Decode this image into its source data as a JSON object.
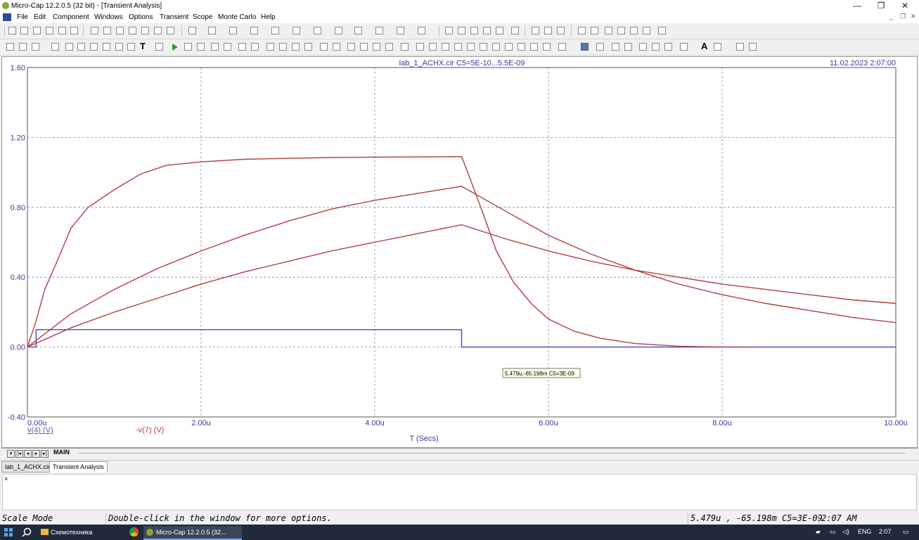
{
  "window": {
    "title": "Micro-Cap 12.2.0.5 (32 bit) - [Transient Analysis]",
    "controls": [
      "—",
      "❐",
      "✕"
    ]
  },
  "menu": {
    "items": [
      "File",
      "Edit",
      "Component",
      "Windows",
      "Options",
      "Transient",
      "Scope",
      "Monte Carlo",
      "Help"
    ],
    "mdi_controls": [
      "_",
      "❐",
      "✕"
    ]
  },
  "plot": {
    "title": "lab_1_ACHX.cir C5=5E-10...5.5E-09",
    "timestamp": "11.02.2023 2:07:00",
    "cursor_readout": "5.479u,-65.198m C5=3E-09",
    "xlabel": "T (Secs)",
    "legend": [
      "v(4) (V)",
      "-v(7) (V)"
    ]
  },
  "chart_data": {
    "type": "line",
    "title": "lab_1_ACHX.cir C5=5E-10...5.5E-09",
    "xlabel": "T (Secs)",
    "ylabel": "",
    "xlim": [
      0,
      10
    ],
    "ylim": [
      -0.4,
      1.6
    ],
    "x_unit": "u",
    "xticks": [
      0,
      2,
      4,
      6,
      8,
      10
    ],
    "xtick_labels": [
      "0.00u",
      "2.00u",
      "4.00u",
      "6.00u",
      "8.00u",
      "10.00u"
    ],
    "yticks": [
      -0.4,
      0,
      0.4,
      0.8,
      1.2,
      1.6
    ],
    "ytick_labels": [
      "-0.40",
      "0.00",
      "0.40",
      "0.80",
      "1.20",
      "1.60"
    ],
    "grid": true,
    "series": [
      {
        "name": "v(4) (V)",
        "color": "#4848b8",
        "x": [
          0,
          0.1,
          0.1,
          5.0,
          5.0,
          10.0
        ],
        "y": [
          0,
          0,
          0.1,
          0.1,
          0,
          0
        ]
      },
      {
        "name": "-v(7) (V)",
        "color": "#b04040",
        "x": [
          0,
          0.1,
          0.2,
          0.35,
          0.5,
          0.7,
          1.0,
          1.3,
          1.6,
          2.0,
          2.5,
          3.0,
          3.5,
          4.0,
          4.5,
          5.0,
          5.1,
          5.25,
          5.4,
          5.6,
          5.8,
          6.0,
          6.3,
          6.6,
          7.0,
          7.5,
          8.0,
          8.3
        ],
        "y": [
          0,
          0.15,
          0.33,
          0.5,
          0.68,
          0.8,
          0.9,
          0.99,
          1.04,
          1.06,
          1.075,
          1.08,
          1.085,
          1.087,
          1.088,
          1.09,
          0.96,
          0.76,
          0.55,
          0.37,
          0.25,
          0.16,
          0.09,
          0.05,
          0.02,
          0.005,
          0,
          0
        ]
      },
      {
        "name": "-v(7) (V)",
        "color": "#b04040",
        "x": [
          0,
          0.5,
          1.0,
          1.5,
          2.0,
          2.5,
          3.0,
          3.5,
          4.0,
          4.5,
          5.0,
          5.5,
          6.0,
          6.5,
          7.0,
          7.5,
          8.0,
          8.5,
          9.0,
          9.5,
          10.0
        ],
        "y": [
          0,
          0.19,
          0.33,
          0.45,
          0.55,
          0.64,
          0.72,
          0.79,
          0.84,
          0.88,
          0.92,
          0.78,
          0.64,
          0.53,
          0.44,
          0.36,
          0.3,
          0.25,
          0.21,
          0.17,
          0.14
        ]
      },
      {
        "name": "-v(7) (V)",
        "color": "#b04040",
        "x": [
          0,
          0.5,
          1.0,
          1.5,
          2.0,
          2.5,
          3.0,
          3.5,
          4.0,
          4.5,
          5.0,
          5.5,
          6.0,
          6.5,
          7.0,
          7.5,
          8.0,
          8.5,
          9.0,
          9.5,
          10.0
        ],
        "y": [
          0,
          0.11,
          0.2,
          0.28,
          0.36,
          0.43,
          0.49,
          0.55,
          0.6,
          0.65,
          0.7,
          0.62,
          0.55,
          0.49,
          0.44,
          0.4,
          0.36,
          0.33,
          0.3,
          0.27,
          0.25
        ]
      }
    ]
  },
  "sheet_tabs": {
    "active": "MAIN",
    "nav": [
      "▾",
      "|◂",
      "◂",
      "▸",
      "▸|"
    ]
  },
  "file_tabs": [
    "lab_1_ACHX.cir",
    "Transient Analysis"
  ],
  "output_pane": {
    "close": "×"
  },
  "status": {
    "mode": "Scale Mode",
    "hint": "Double-click in the window for more options.",
    "readout": "5.479u , -65.198m C5=3E-09",
    "time": "2:07 AM"
  },
  "taskbar": {
    "apps": [
      "Схемотехника",
      "Micro-Cap 12.2.0.5 (32..."
    ],
    "lang": "ENG",
    "clock": "2:07"
  }
}
